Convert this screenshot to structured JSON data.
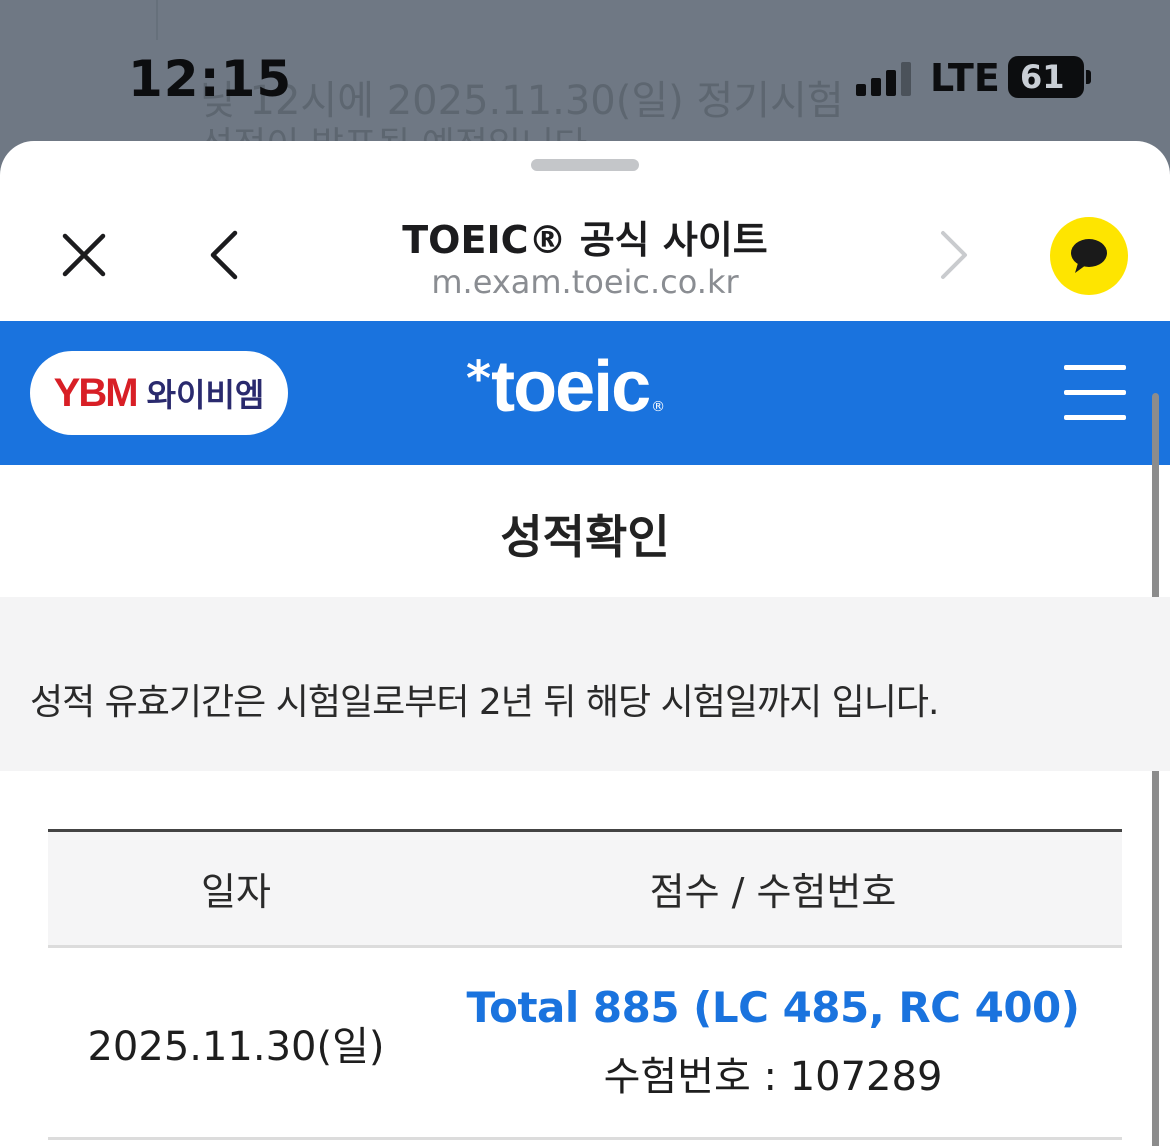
{
  "background": {
    "line1": "낮 12시에 2025.11.30(일) 정기시험",
    "line2": "성적이 발표될 예정입니다"
  },
  "status_bar": {
    "time": "12:15",
    "network": "LTE",
    "battery": "61"
  },
  "browser_header": {
    "title": "TOEIC® 공식 사이트",
    "url": "m.exam.toeic.co.kr",
    "close_icon": "close-icon",
    "back_icon": "chevron-left-icon",
    "forward_icon": "chevron-right-icon",
    "chat_icon": "kakao-chat-icon"
  },
  "site_nav": {
    "partner_mark": "YBM",
    "partner_name": "와이비엠",
    "logo_star": "*",
    "logo_text": "toeic",
    "logo_reg": "®",
    "menu_icon": "hamburger-menu-icon"
  },
  "page": {
    "title": "성적확인",
    "notice": "성적 유효기간은 시험일로부터 2년 뒤 해당 시험일까지 입니다."
  },
  "table": {
    "headers": [
      "일자",
      "점수 / 수험번호"
    ],
    "rows": [
      {
        "date": "2025.11.30(일)",
        "score": "Total 885 (LC 485, RC 400)",
        "registration": "수험번호 : 107289"
      }
    ]
  },
  "colors": {
    "brand_blue": "#1a73de",
    "kakao_yellow": "#fee500",
    "ybm_red": "#d81f26"
  }
}
